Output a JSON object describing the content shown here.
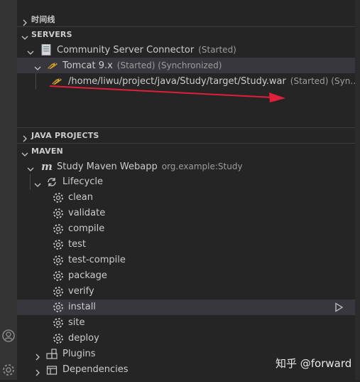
{
  "timeline": {
    "label": "时间线"
  },
  "servers": {
    "label": "SERVERS",
    "connector": {
      "name": "Community Server Connector",
      "status": "(Started)"
    },
    "tomcat": {
      "name": "Tomcat 9.x",
      "status": "(Started) (Synchronized)"
    },
    "deployment": {
      "path": "/home/liwu/project/java/Study/target/Study.war",
      "status": "(Started) (Syn…"
    }
  },
  "java_projects": {
    "label": "JAVA PROJECTS"
  },
  "maven": {
    "label": "MAVEN",
    "project": {
      "name": "Study Maven Webapp",
      "id": "org.example:Study"
    },
    "lifecycle": {
      "label": "Lifecycle",
      "goals": [
        "clean",
        "validate",
        "compile",
        "test",
        "test-compile",
        "package",
        "verify",
        "install",
        "site",
        "deploy"
      ],
      "selected": "install"
    },
    "plugins_label": "Plugins",
    "dependencies_label": "Dependencies"
  },
  "watermark": "知乎 @forward",
  "colors": {
    "annotation_arrow": "#e0203a",
    "selection": "#37373d"
  }
}
